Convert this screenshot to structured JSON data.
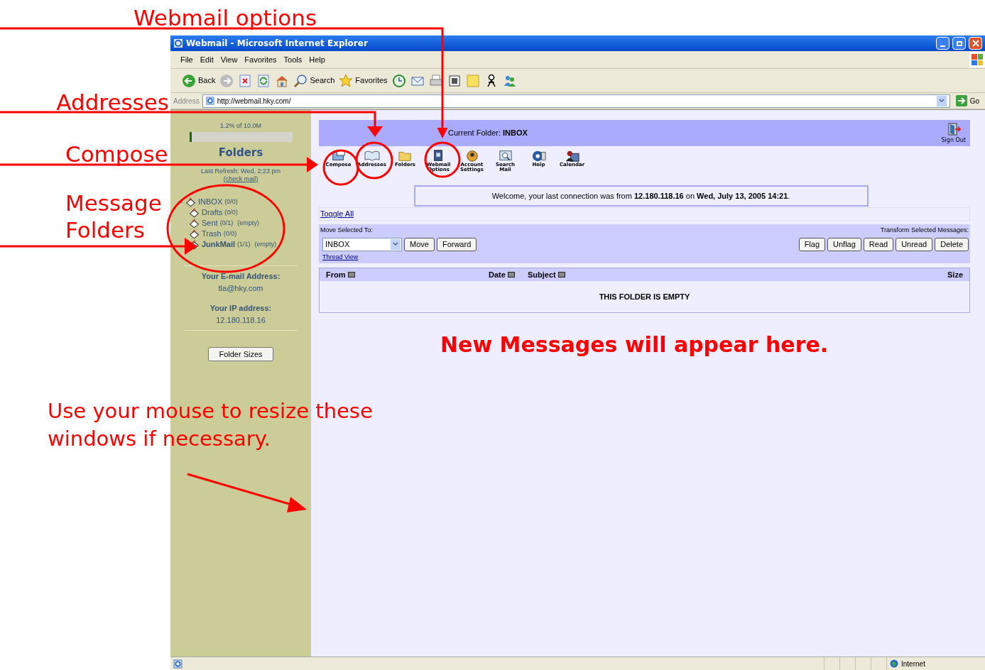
{
  "browser": {
    "title": "Webmail - Microsoft Internet Explorer",
    "menu": [
      "File",
      "Edit",
      "View",
      "Favorites",
      "Tools",
      "Help"
    ],
    "toolbar": [
      {
        "kind": "back",
        "label": "Back"
      },
      {
        "kind": "forward"
      },
      {
        "kind": "stop"
      },
      {
        "kind": "refresh"
      },
      {
        "kind": "home"
      },
      {
        "kind": "search",
        "label": "Search"
      },
      {
        "kind": "favorites",
        "label": "Favorites"
      },
      {
        "kind": "history"
      },
      {
        "kind": "mail"
      },
      {
        "kind": "print"
      },
      {
        "kind": "edit"
      },
      {
        "kind": "note"
      },
      {
        "kind": "person"
      },
      {
        "kind": "messenger"
      }
    ],
    "address_label": "Address",
    "url": "http://webmail.hky.com/",
    "go": "Go",
    "status_zone": "Internet"
  },
  "sidebar": {
    "quota_text": "1.2% of 10.0M",
    "quota": {
      "level": 0.012
    },
    "heading": "Folders",
    "last_refresh": "Last Refresh: Wed, 2:23 pm",
    "check_mail": "(check mail)",
    "folders": [
      {
        "name": "INBOX",
        "count": "(0/0)",
        "unread": false,
        "expanded": true,
        "children": [
          {
            "name": "Drafts",
            "count": "(0/0)",
            "unread": false
          },
          {
            "name": "Sent",
            "count": "(0/1)",
            "unread": false,
            "purge": "(empty)"
          },
          {
            "name": "Trash",
            "count": "(0/0)",
            "unread": false
          },
          {
            "name": "JunkMail",
            "count": "(1/1)",
            "unread": true,
            "purge": "(empty)"
          }
        ]
      }
    ],
    "email_label": "Your E-mail Address:",
    "email": "tla@hky.com",
    "ip_label": "Your IP address:",
    "ip": "12.180.118.16",
    "button": "Folder Sizes"
  },
  "main": {
    "current_folder_label": "Current Folder:",
    "current_folder": "INBOX",
    "sign_out": "Sign Out",
    "tools": [
      {
        "kind": "compose",
        "label": "Compose"
      },
      {
        "kind": "addresses",
        "label": "Addresses"
      },
      {
        "kind": "folders",
        "label": "Folders"
      },
      {
        "kind": "options",
        "label": "Webmail Options"
      },
      {
        "kind": "account",
        "label": "Account Settings"
      },
      {
        "kind": "search",
        "label": "Search Mail"
      },
      {
        "kind": "help",
        "label": "Help"
      },
      {
        "kind": "calendar",
        "label": "Calendar"
      }
    ],
    "welcome": "Welcome, your last connection was from **12.180.118.16** on **Wed, July 13, 2005 14:21**.",
    "toggle_all": "Toggle All",
    "move_label": "Move Selected To:",
    "move_select": "INBOX",
    "move_buttons": [
      "Move",
      "Forward"
    ],
    "thread_view": "Thread View",
    "transform_label": "Transform Selected Messages:",
    "transform_buttons": [
      "Flag",
      "Unflag",
      "Read",
      "Unread",
      "Delete"
    ],
    "columns": [
      {
        "label": "From",
        "sortable": true
      },
      {
        "label": "Date",
        "sortable": true
      },
      {
        "label": "Subject",
        "sortable": true
      },
      {
        "label": "Size",
        "sortable": false
      }
    ],
    "empty_message": "THIS FOLDER IS EMPTY"
  },
  "annotations": [
    {
      "text": "Webmail options"
    },
    {
      "text": "Addresses"
    },
    {
      "text": "Compose"
    },
    {
      "text": "Message Folders"
    },
    {
      "text": "Use your mouse to resize these windows if necessary."
    },
    {
      "text": "New Messages will appear here."
    }
  ]
}
